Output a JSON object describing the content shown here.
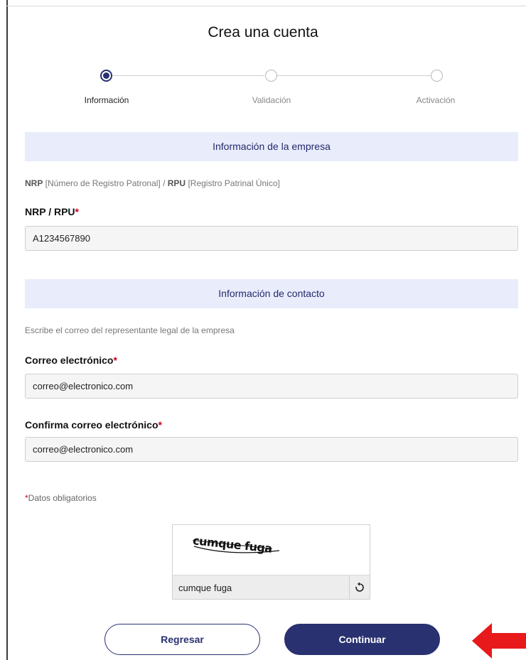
{
  "page": {
    "title": "Crea una cuenta"
  },
  "stepper": {
    "steps": [
      {
        "label": "Información",
        "active": true
      },
      {
        "label": "Validación",
        "active": false
      },
      {
        "label": "Activación",
        "active": false
      }
    ],
    "active_color": "#2a3170"
  },
  "company_section": {
    "header": "Información de la empresa",
    "note_nrp_abbr": "NRP",
    "note_nrp_desc": " [Número de Registro Patronal] / ",
    "note_rpu_abbr": "RPU",
    "note_rpu_desc": " [Registro Patrinal Único]",
    "field_label": "NRP / RPU",
    "field_value": "A1234567890"
  },
  "contact_section": {
    "header": "Información de contacto",
    "note": "Escribe el correo del representante legal de la empresa",
    "email_label": "Correo electrónico",
    "email_value": "correo@electronico.com",
    "confirm_label": "Confirma correo electrónico",
    "confirm_value": "correo@electronico.com"
  },
  "required_mark": "*",
  "required_note": "Datos obligatorios",
  "captcha": {
    "image_text": "cumque fuga",
    "input_value": "cumque fuga",
    "refresh_icon": "refresh-icon"
  },
  "buttons": {
    "back_label": "Regresar",
    "next_label": "Continuar"
  },
  "colors": {
    "brand": "#2a3170",
    "section_bg": "#e9ecfb",
    "required": "#d0021b",
    "annotation_arrow": "#e8191b"
  }
}
